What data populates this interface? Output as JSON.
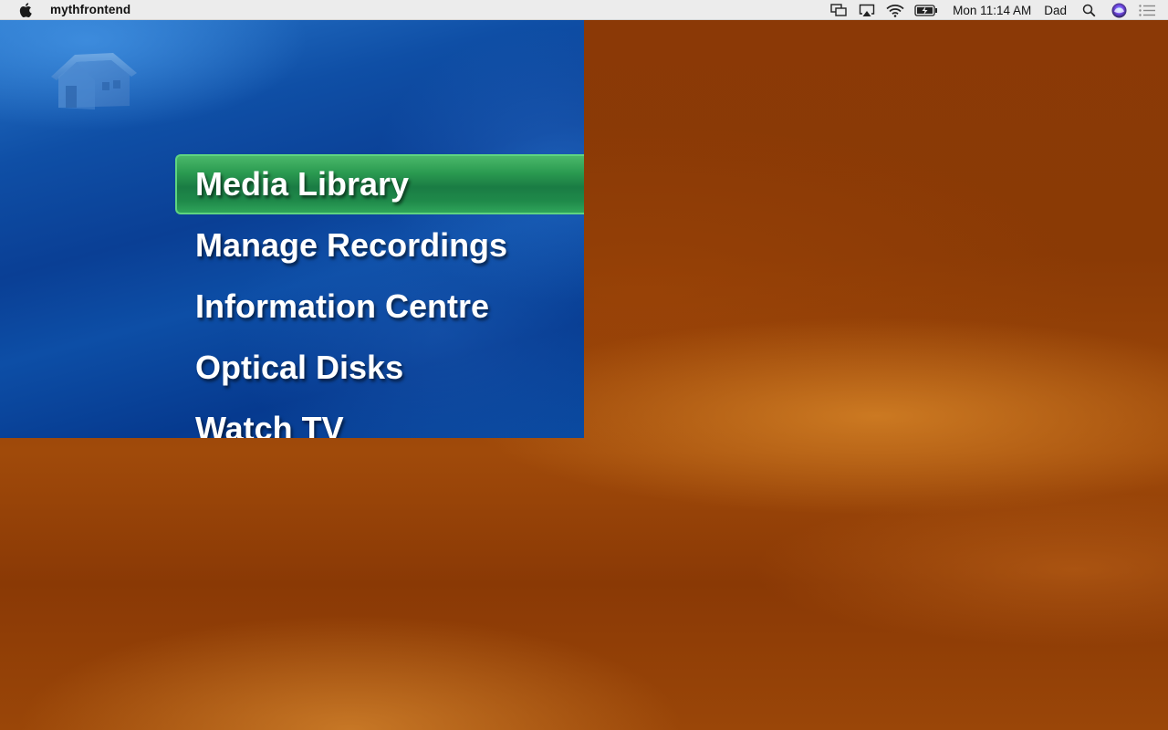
{
  "menubar": {
    "apple_icon": "apple-logo-icon",
    "app_name": "mythfrontend",
    "status_icons": [
      "display-mirroring-icon",
      "airplay-icon",
      "wifi-icon",
      "battery-charging-icon"
    ],
    "clock": "Mon 11:14 AM",
    "user": "Dad",
    "trailing_icons": [
      "spotlight-search-icon",
      "siri-icon",
      "notification-center-icon"
    ]
  },
  "myth": {
    "header_icon": "house-icon",
    "menu_items": [
      {
        "label": "Media Library",
        "selected": true
      },
      {
        "label": "Manage Recordings",
        "selected": false
      },
      {
        "label": "Information Centre",
        "selected": false
      },
      {
        "label": "Optical Disks",
        "selected": false
      },
      {
        "label": "Watch TV",
        "selected": false
      }
    ]
  },
  "colors": {
    "selection_green": "#1f8a4a",
    "window_blue": "#0a3f95",
    "wallpaper_orange": "#a04a0a",
    "menubar_bg": "#ececec"
  }
}
